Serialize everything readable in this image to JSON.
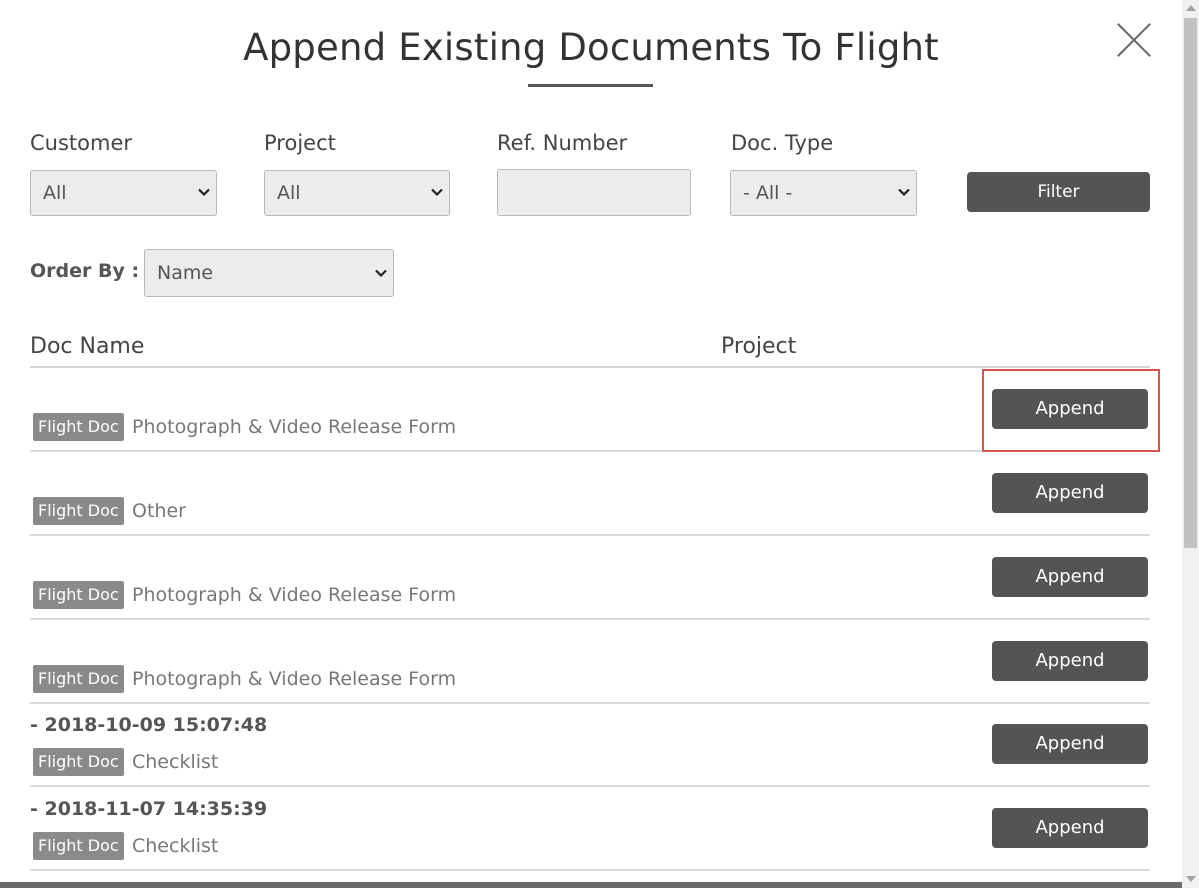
{
  "modal": {
    "title": "Append Existing Documents To Flight"
  },
  "filters": {
    "customer_label": "Customer",
    "customer_value": "All",
    "project_label": "Project",
    "project_value": "All",
    "ref_label": "Ref. Number",
    "ref_value": "",
    "doctype_label": "Doc. Type",
    "doctype_value": "- All -",
    "filter_button": "Filter",
    "orderby_label": "Order By :",
    "orderby_value": "Name"
  },
  "table": {
    "headers": {
      "doc_name": "Doc Name",
      "project": "Project"
    },
    "rows": [
      {
        "timestamp": "",
        "badge": "Flight Doc",
        "name": "Photograph & Video Release Form",
        "action": "Append",
        "highlighted": true
      },
      {
        "timestamp": "",
        "badge": "Flight Doc",
        "name": "Other",
        "action": "Append"
      },
      {
        "timestamp": "",
        "badge": "Flight Doc",
        "name": "Photograph & Video Release Form",
        "action": "Append"
      },
      {
        "timestamp": "",
        "badge": "Flight Doc",
        "name": "Photograph & Video Release Form",
        "action": "Append"
      },
      {
        "timestamp": "- 2018-10-09 15:07:48",
        "badge": "Flight Doc",
        "name": "Checklist",
        "action": "Append"
      },
      {
        "timestamp": "- 2018-11-07 14:35:39",
        "badge": "Flight Doc",
        "name": "Checklist",
        "action": "Append"
      }
    ]
  },
  "colors": {
    "button_bg": "#545454",
    "badge_bg": "#8a8a8a",
    "highlight": "#d9534f"
  },
  "icons": {
    "close": "close-icon",
    "dropdown": "chevron-down-icon"
  }
}
